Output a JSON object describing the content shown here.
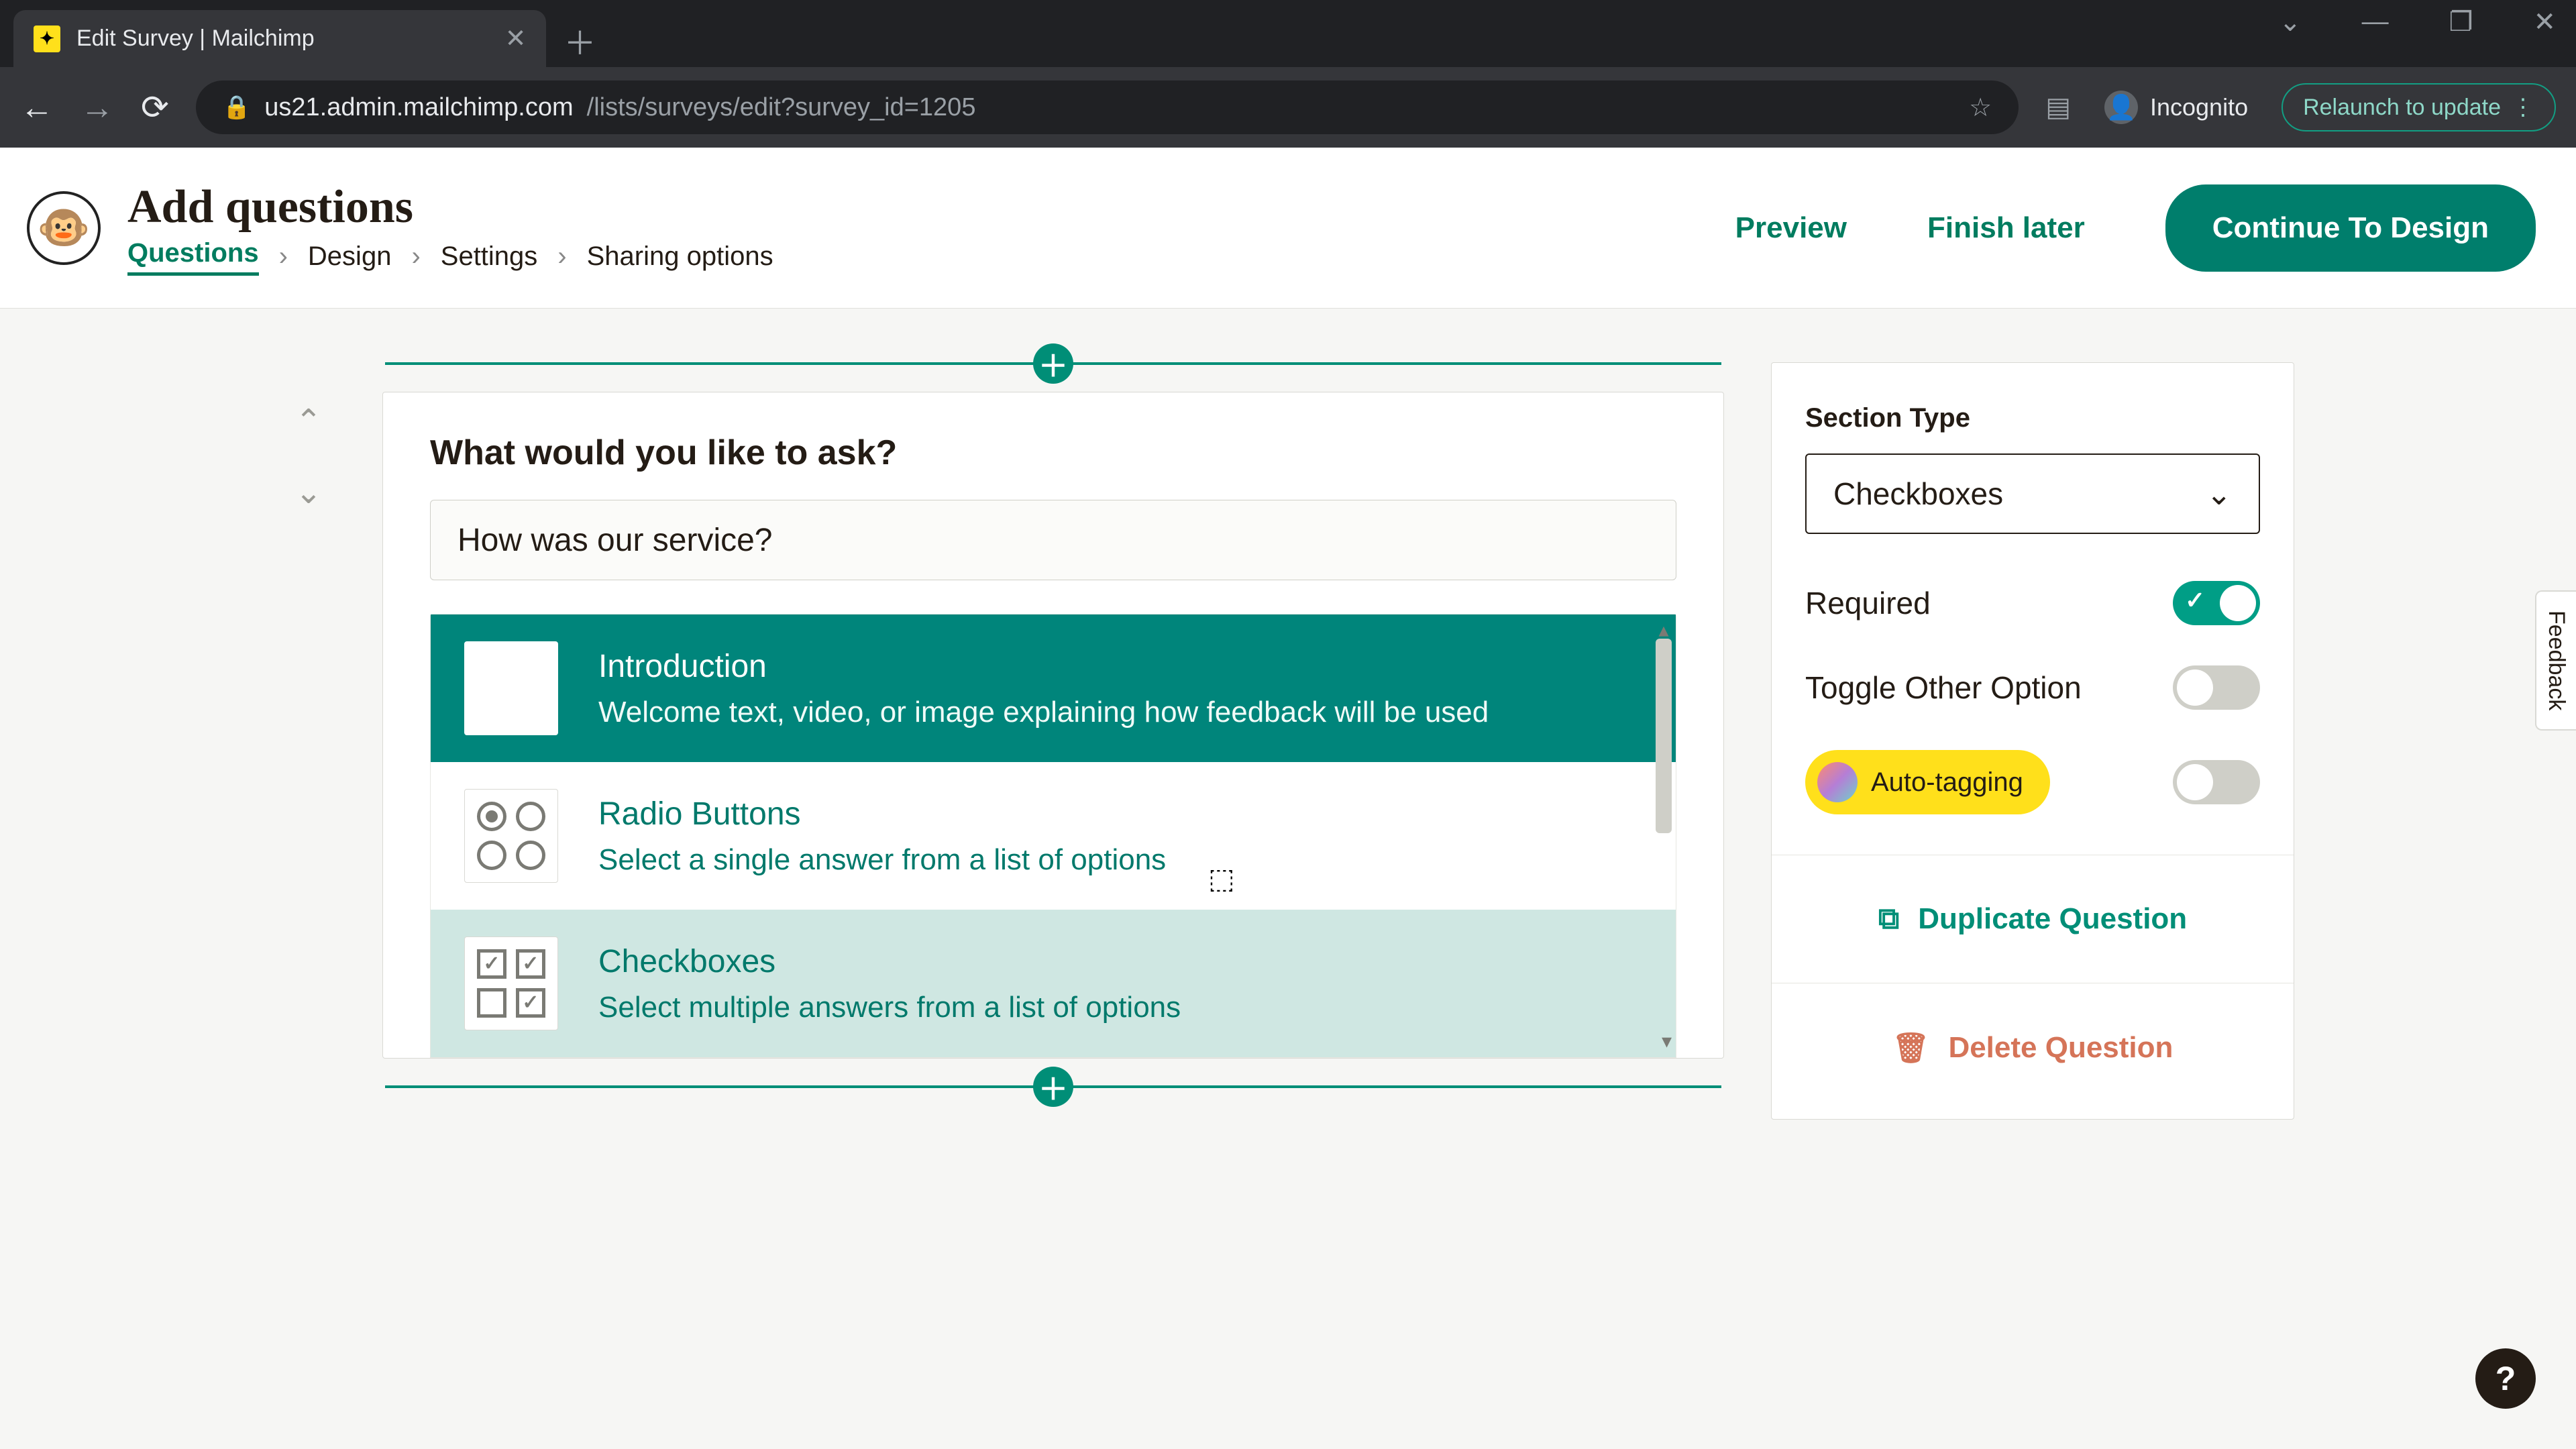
{
  "browser": {
    "tab_title": "Edit Survey | Mailchimp",
    "url_host": "us21.admin.mailchimp.com",
    "url_path": "/lists/surveys/edit?survey_id=1205",
    "incognito_label": "Incognito",
    "relaunch_label": "Relaunch to update"
  },
  "header": {
    "title": "Add questions",
    "crumbs": [
      "Questions",
      "Design",
      "Settings",
      "Sharing options"
    ],
    "active_crumb_index": 0,
    "preview": "Preview",
    "finish_later": "Finish later",
    "continue": "Continue To Design"
  },
  "question": {
    "prompt_label": "What would you like to ask?",
    "value": "How was our service?"
  },
  "type_picker": {
    "items": [
      {
        "title": "Introduction",
        "desc": "Welcome text, video, or image explaining how feedback will be used",
        "icon": "smile-plus-icon",
        "selected": true
      },
      {
        "title": "Radio Buttons",
        "desc": "Select a single answer from a list of options",
        "icon": "radio-buttons-icon",
        "selected": false
      },
      {
        "title": "Checkboxes",
        "desc": "Select multiple answers from a list of options",
        "icon": "checkboxes-icon",
        "selected": false
      }
    ],
    "hover_index": 2
  },
  "right_panel": {
    "section_type_label": "Section Type",
    "section_type_value": "Checkboxes",
    "required_label": "Required",
    "required_on": true,
    "other_label": "Toggle Other Option",
    "other_on": false,
    "autotag_label": "Auto-tagging",
    "autotag_on": false,
    "duplicate_label": "Duplicate Question",
    "delete_label": "Delete Question"
  },
  "misc": {
    "feedback_tab": "Feedback",
    "help": "?"
  }
}
